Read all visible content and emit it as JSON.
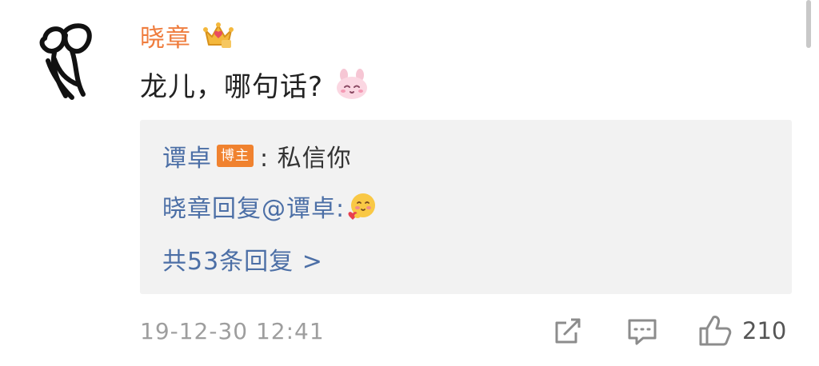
{
  "comment": {
    "username": "晓章",
    "username_color": "#ef7d3e",
    "vip_icon": "crown-icon",
    "text": "龙儿，哪句话?",
    "emoji": "bunny-emoji-icon"
  },
  "replies": {
    "first": {
      "name": "谭卓",
      "badge": "博主",
      "text": ": 私信你"
    },
    "second": {
      "prefix": "晓章回复",
      "mention": "@谭卓:",
      "emoji": "hugging-heart-emoji-icon"
    },
    "more_link": "共53条回复 >",
    "link_color": "#4c6fa6",
    "badge_color": "#f0822f"
  },
  "footer": {
    "timestamp": "19-12-30 12:41",
    "like_count": "210"
  }
}
